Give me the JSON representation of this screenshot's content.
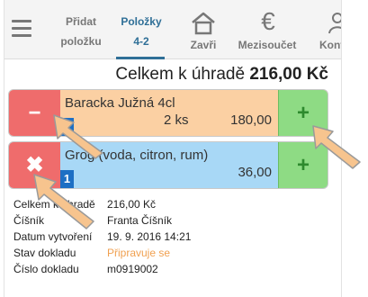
{
  "toolbar": {
    "tabs": [
      {
        "label_line1": "Přidat",
        "label_line2": "položku"
      },
      {
        "label_line1": "Položky",
        "label_line2": "4-2"
      },
      {
        "label": "Zavři"
      },
      {
        "label": "Mezisoučet"
      },
      {
        "label": "Kont"
      }
    ]
  },
  "total": {
    "label": "Celkem k úhradě",
    "amount": "216,00 Kč"
  },
  "items": [
    {
      "name": "Baracka Južná 4cl",
      "qty": "2 ks",
      "price": "180,00",
      "badge": "1",
      "left_icon": "minus-icon",
      "right_icon": "plus-icon"
    },
    {
      "name": "Grog (voda, citron, rum)",
      "qty": "",
      "price": "36,00",
      "badge": "1",
      "left_icon": "close-icon",
      "right_icon": "plus-icon"
    }
  ],
  "info": {
    "rows": [
      {
        "key": "Celkem k úhradě",
        "value": "216,00 Kč"
      },
      {
        "key": "Číšník",
        "value": "Franta Číšník"
      },
      {
        "key": "Datum vytvoření",
        "value": "19. 9. 2016 14:21"
      },
      {
        "key": "Stav dokladu",
        "value": "Připravuje se"
      },
      {
        "key": "Číslo dokladu",
        "value": "m0919002"
      }
    ]
  },
  "colors": {
    "accent": "#2f6f97",
    "row1_bg": "#fbd0a3",
    "row2_bg": "#a8d8f6",
    "remove": "#ef6c6c",
    "add": "#8edb84",
    "state": "#f0a050"
  }
}
